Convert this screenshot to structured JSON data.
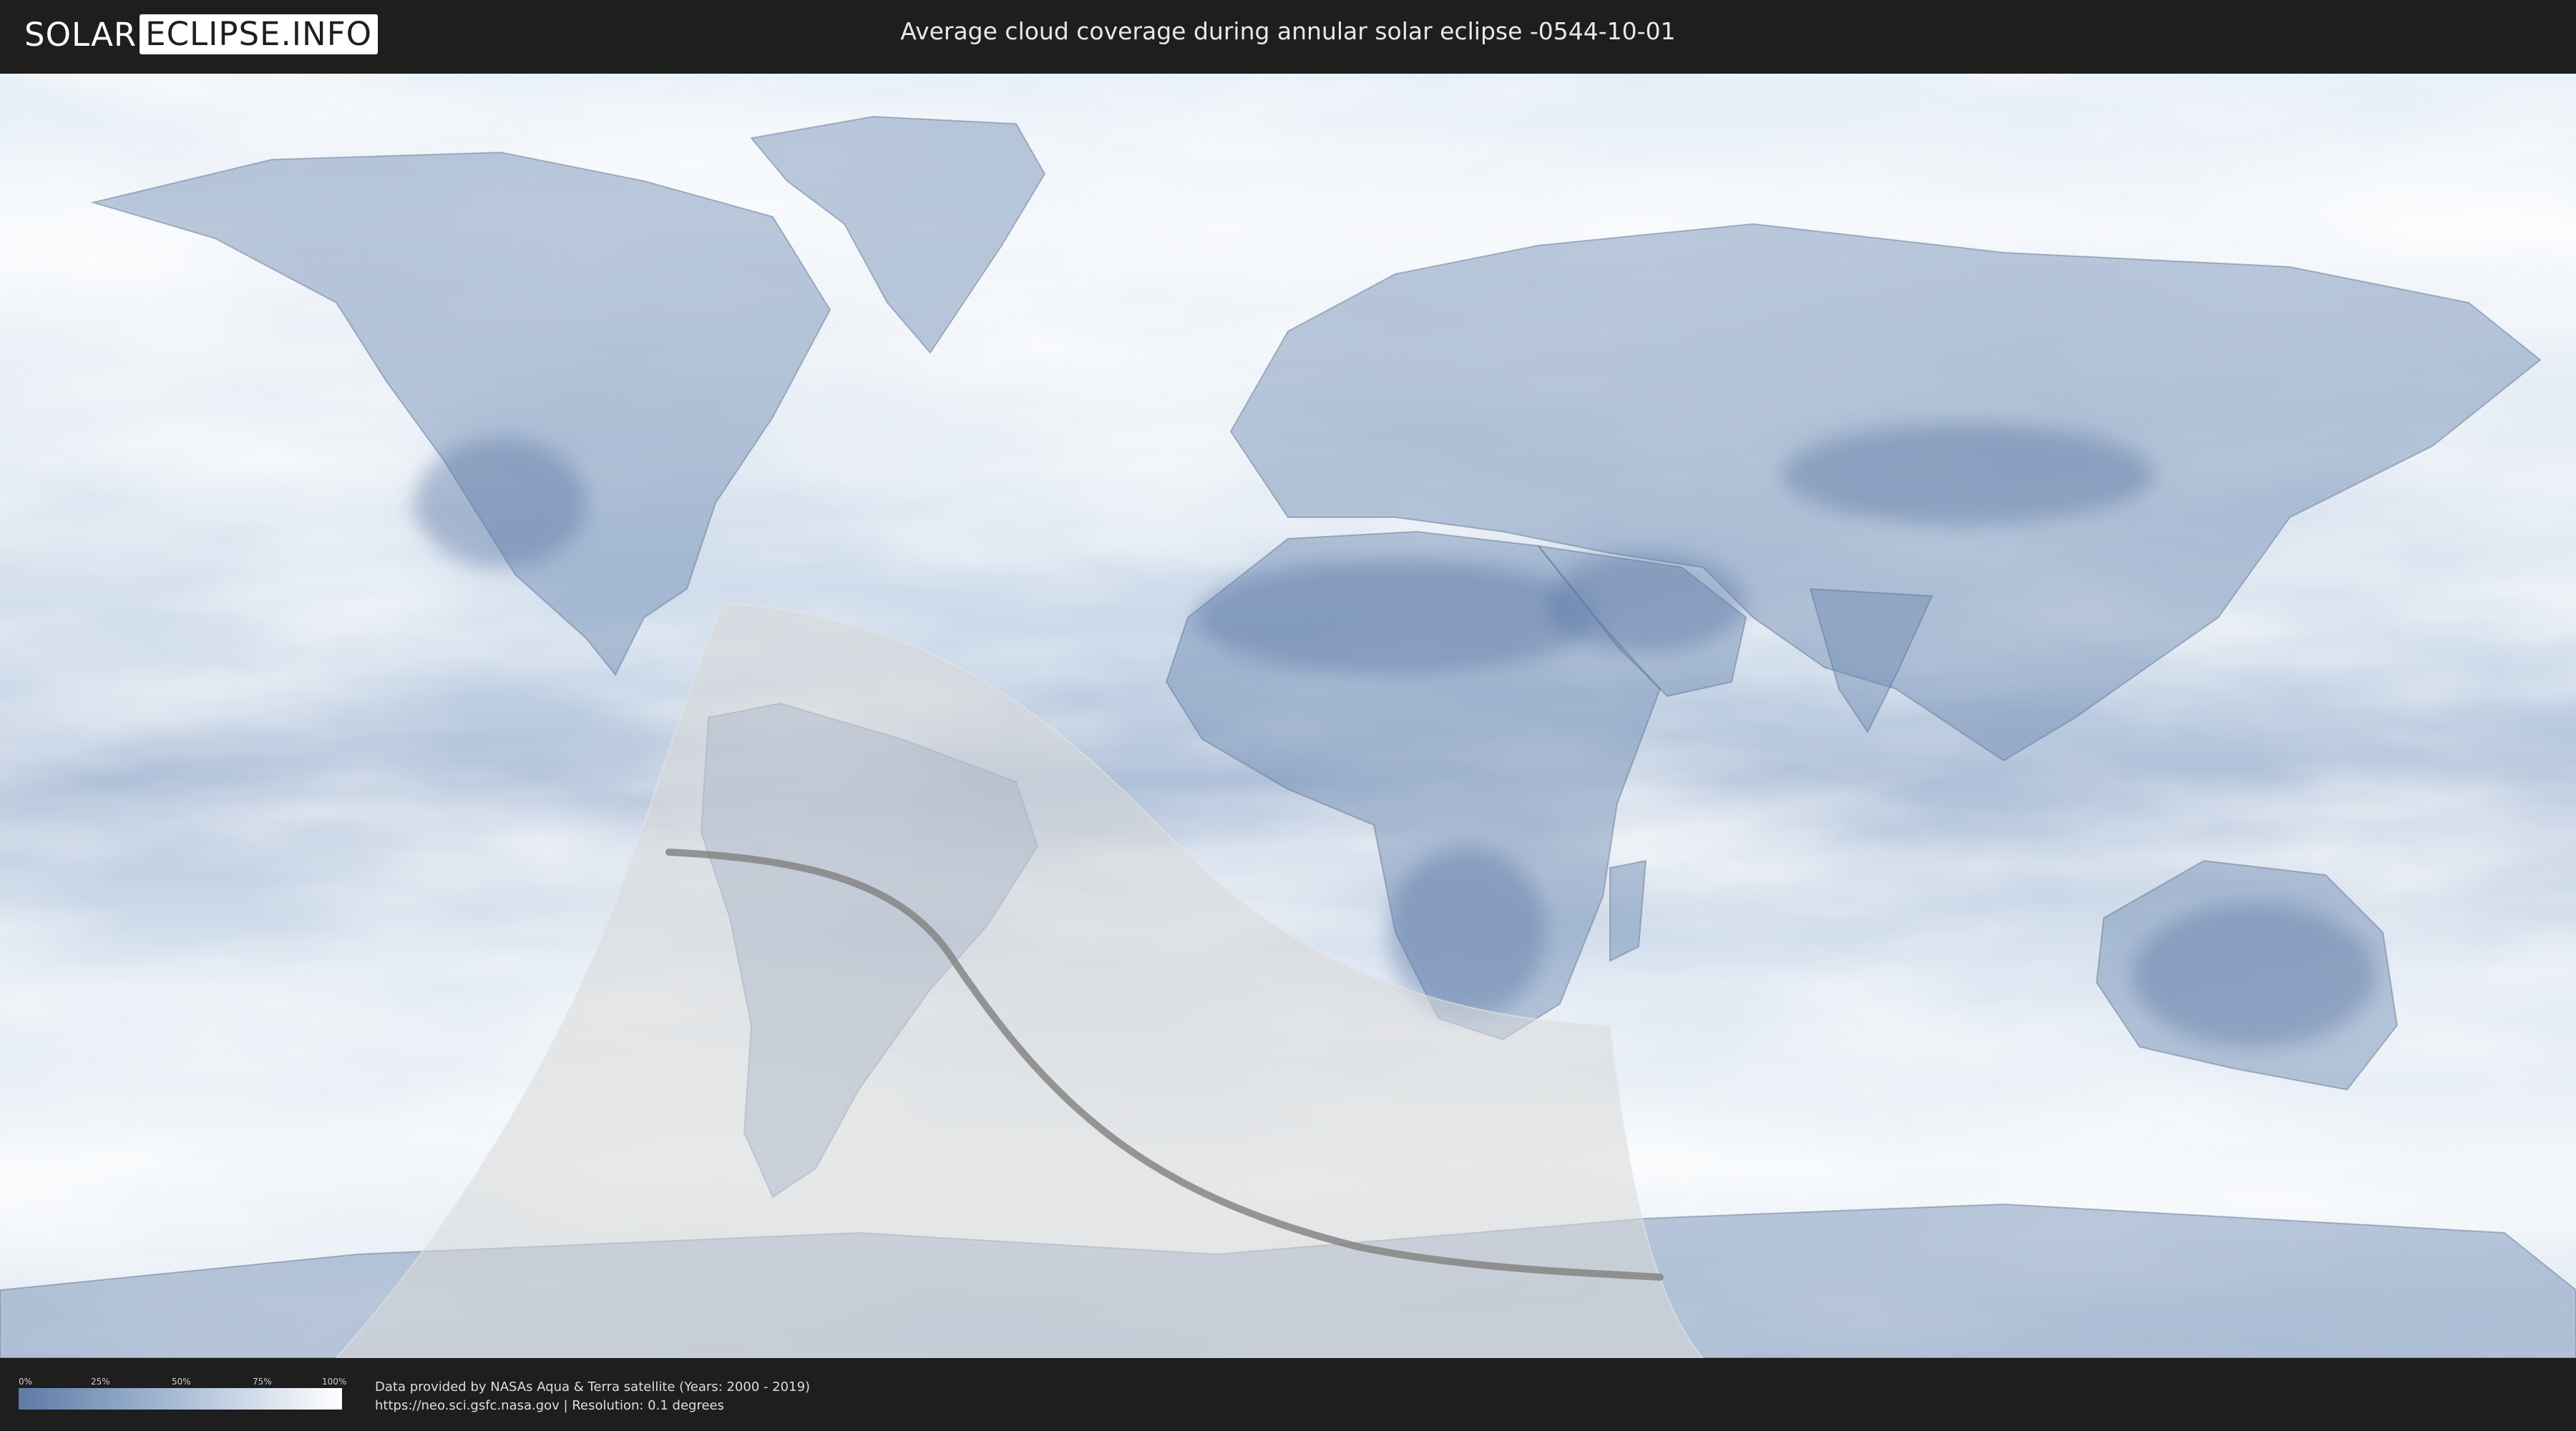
{
  "header": {
    "logo_part1": "SOLAR",
    "logo_part2": "ECLIPSE.INFO",
    "title": "Average cloud coverage during annular solar eclipse -0544-10-01"
  },
  "map": {
    "layer": "average cloud coverage",
    "colors": {
      "ocean_clear": "#5d7aa6",
      "cloud": "#ffffff",
      "eclipse_band": "#d9d9d9",
      "central_line": "#808080"
    }
  },
  "legend": {
    "ticks": [
      "0%",
      "25%",
      "50%",
      "75%",
      "100%"
    ],
    "gradient_colors": [
      "#5d7aa6",
      "#92a9c8",
      "#cdd9e8",
      "#ffffff"
    ]
  },
  "footer": {
    "credit_line1": "Data provided by NASAs Aqua & Terra satellite (Years: 2000 - 2019)",
    "credit_line2": "https://neo.sci.gsfc.nasa.gov | Resolution: 0.1 degrees"
  }
}
